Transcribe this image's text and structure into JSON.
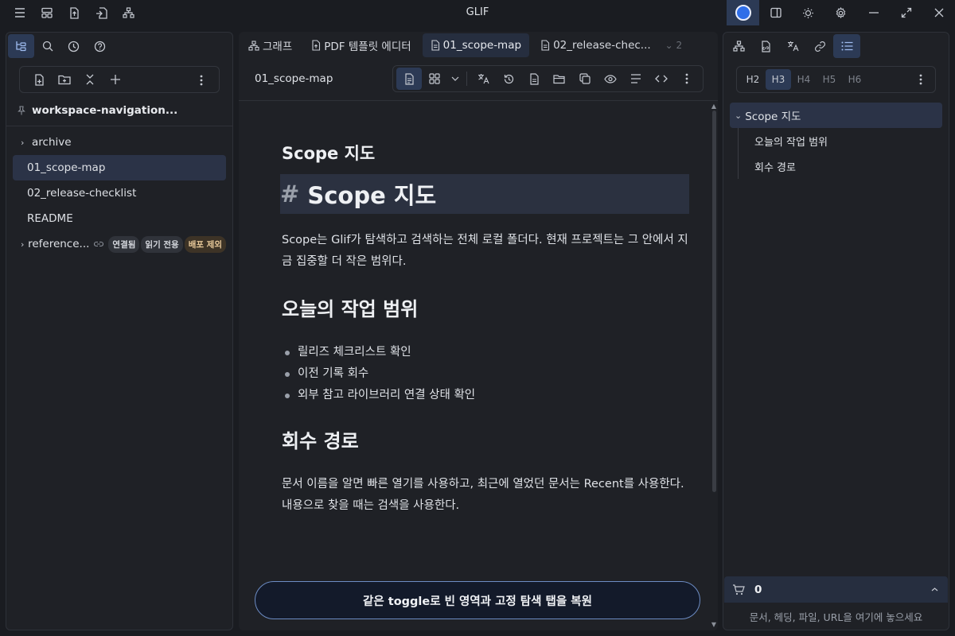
{
  "window": {
    "title": "GLIF"
  },
  "titlebar": {
    "left_icons": [
      "menu-icon",
      "layout-icon",
      "upload-file-icon",
      "exit-file-icon",
      "sitemap-icon"
    ],
    "right_icons": [
      "record-icon",
      "sidebar-toggle-icon",
      "theme-icon",
      "settings-icon",
      "minimize-icon",
      "maximize-icon",
      "close-icon"
    ]
  },
  "left_panel": {
    "tabs": [
      "file-tree-icon",
      "search-icon",
      "history-icon",
      "help-icon"
    ],
    "toolbar": [
      "new-file-icon",
      "new-folder-icon",
      "collapse-icon",
      "add-icon",
      "more-icon"
    ],
    "workspace_title": "workspace-navigation...",
    "tree": [
      {
        "label": "archive",
        "folder": true
      },
      {
        "label": "01_scope-map",
        "selected": true
      },
      {
        "label": "02_release-checklist"
      },
      {
        "label": "README"
      },
      {
        "label": "reference...",
        "folder": true,
        "badges": [
          "연결됨",
          "읽기 전용",
          "배포 제외"
        ]
      }
    ]
  },
  "center": {
    "tabs": [
      {
        "label": "그래프",
        "icon": "graph-icon"
      },
      {
        "label": "PDF 템플릿 에디터",
        "icon": "pdf-icon"
      },
      {
        "label": "01_scope-map",
        "icon": "file-icon",
        "active": true
      },
      {
        "label": "02_release-chec...",
        "icon": "file-icon"
      }
    ],
    "tab_overflow": "⌄ 2",
    "doc_name": "01_scope-map",
    "doc": {
      "rendered_title": "Scope 지도",
      "source_heading_hash": "#",
      "source_heading": "Scope 지도",
      "intro": "Scope는 Glif가 탐색하고 검색하는 전체 로컬 폴더다. 현재 프로젝트는 그 안에서 지금 집중할 더 작은 범위다.",
      "section1_title": "오늘의 작업 범위",
      "section1_items": [
        "릴리즈 체크리스트 확인",
        "이전 기록 회수",
        "외부 참고 라이브러리 연결 상태 확인"
      ],
      "section2_title": "회수 경로",
      "section2_text": "문서 이름을 알면 빠른 열기를 사용하고, 최근에 열었던 문서는 Recent를 사용한다. 내용으로 찾을 때는 검색을 사용한다."
    },
    "cta": "같은 toggle로 빈 영역과 고정 탐색 탭을 복원"
  },
  "right_panel": {
    "heading_levels": [
      {
        "label": "H2",
        "state": "normal"
      },
      {
        "label": "H3",
        "state": "active"
      },
      {
        "label": "H4",
        "state": "dim"
      },
      {
        "label": "H5",
        "state": "dim"
      },
      {
        "label": "H6",
        "state": "dim"
      }
    ],
    "outline_root": "Scope 지도",
    "outline_children": [
      "오늘의 작업 범위",
      "회수 경로"
    ],
    "cart_count": "0",
    "drop_hint": "문서, 헤딩, 파일, URL을 여기에 놓으세요"
  }
}
